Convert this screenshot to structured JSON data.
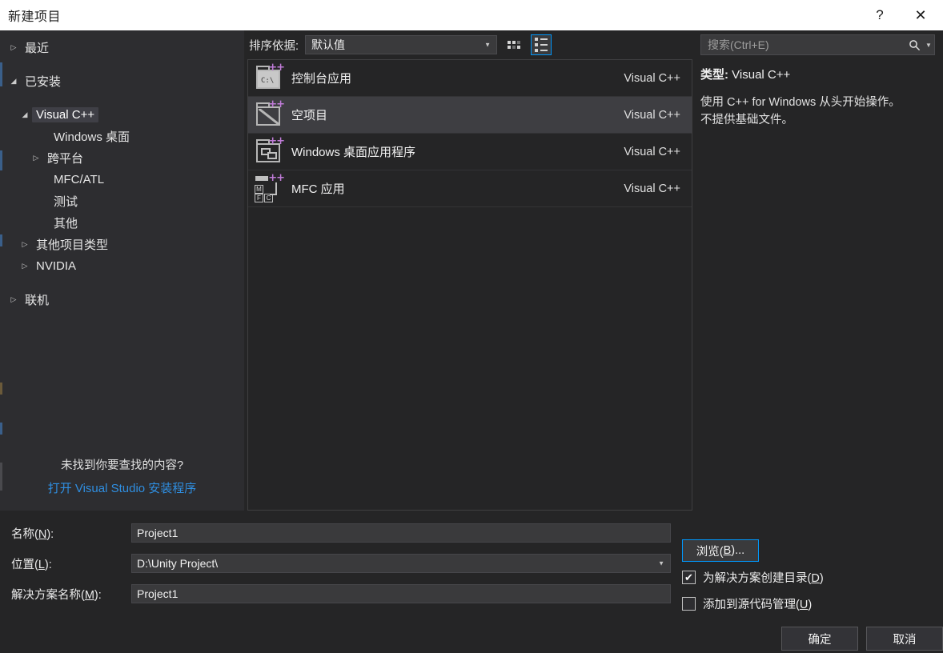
{
  "window": {
    "title": "新建项目",
    "help_label": "?",
    "close_label": "✕"
  },
  "sidebar": {
    "items": [
      {
        "label": "最近",
        "twisty": "▷",
        "indent": 0,
        "selected": false
      },
      {
        "label": "已安装",
        "twisty": "◢",
        "indent": 0,
        "selected": false
      },
      {
        "label": "Visual C++",
        "twisty": "◢",
        "indent": 1,
        "selected": true
      },
      {
        "label": "Windows 桌面",
        "twisty": "",
        "indent": 3,
        "selected": false
      },
      {
        "label": "跨平台",
        "twisty": "▷",
        "indent": 2,
        "selected": false
      },
      {
        "label": "MFC/ATL",
        "twisty": "",
        "indent": 3,
        "selected": false
      },
      {
        "label": "测试",
        "twisty": "",
        "indent": 3,
        "selected": false
      },
      {
        "label": "其他",
        "twisty": "",
        "indent": 3,
        "selected": false
      },
      {
        "label": "其他项目类型",
        "twisty": "▷",
        "indent": 1,
        "selected": false
      },
      {
        "label": "NVIDIA",
        "twisty": "▷",
        "indent": 1,
        "selected": false
      },
      {
        "label": "联机",
        "twisty": "▷",
        "indent": 0,
        "selected": false
      }
    ],
    "not_found_question": "未找到你要查找的内容?",
    "installer_link": "打开 Visual Studio 安装程序"
  },
  "toolbar": {
    "sort_label": "排序依据:",
    "sort_value": "默认值",
    "sort_arrow": "▼",
    "grid_view_name": "grid-view",
    "list_view_name": "list-view"
  },
  "templates": {
    "rows": [
      {
        "name": "控制台应用",
        "language": "Visual C++",
        "icon": "console-app-icon",
        "selected": false
      },
      {
        "name": "空项目",
        "language": "Visual C++",
        "icon": "empty-project-icon",
        "selected": true
      },
      {
        "name": "Windows 桌面应用程序",
        "language": "Visual C++",
        "icon": "windows-desktop-app-icon",
        "selected": false
      },
      {
        "name": "MFC 应用",
        "language": "Visual C++",
        "icon": "mfc-app-icon",
        "selected": false
      }
    ],
    "console_icon_text": "C:\\",
    "plusplus": "++",
    "mfc_m": "M",
    "mfc_f": "F",
    "mfc_c": "C"
  },
  "search": {
    "placeholder": "搜索(Ctrl+E)",
    "value": "",
    "caret": "▼"
  },
  "details": {
    "type_label": "类型:",
    "type_value": "Visual C++",
    "description_line1": "使用 C++ for Windows 从头开始操作。",
    "description_line2": "不提供基础文件。"
  },
  "form": {
    "name_label_pre": "名称(",
    "name_label_key": "N",
    "name_label_post": "):",
    "name_value": "Project1",
    "location_label_pre": "位置(",
    "location_label_key": "L",
    "location_label_post": "):",
    "location_value": "D:\\Unity Project\\",
    "location_arrow": "▼",
    "solution_label_pre": "解决方案名称(",
    "solution_label_key": "M",
    "solution_label_post": "):",
    "solution_value": "Project1",
    "browse_pre": "浏览(",
    "browse_key": "B",
    "browse_post": ")...",
    "check1_pre": "为解决方案创建目录(",
    "check1_key": "D",
    "check1_post": ")",
    "check1_checked": "✔",
    "check2_pre": "添加到源代码管理(",
    "check2_key": "U",
    "check2_post": ")",
    "check2_checked": ""
  },
  "footer": {
    "ok_label": "确定",
    "cancel_label": "取消"
  },
  "colors": {
    "accent_blue": "#0097FB",
    "link_blue": "#2F8EE0",
    "titlebar_bg": "#FFFFFF",
    "panel_bg": "#252526",
    "sidebar_bg": "#2D2D30",
    "selection_bg": "#3E3E42",
    "cpp_magenta": "#C07CD8"
  }
}
